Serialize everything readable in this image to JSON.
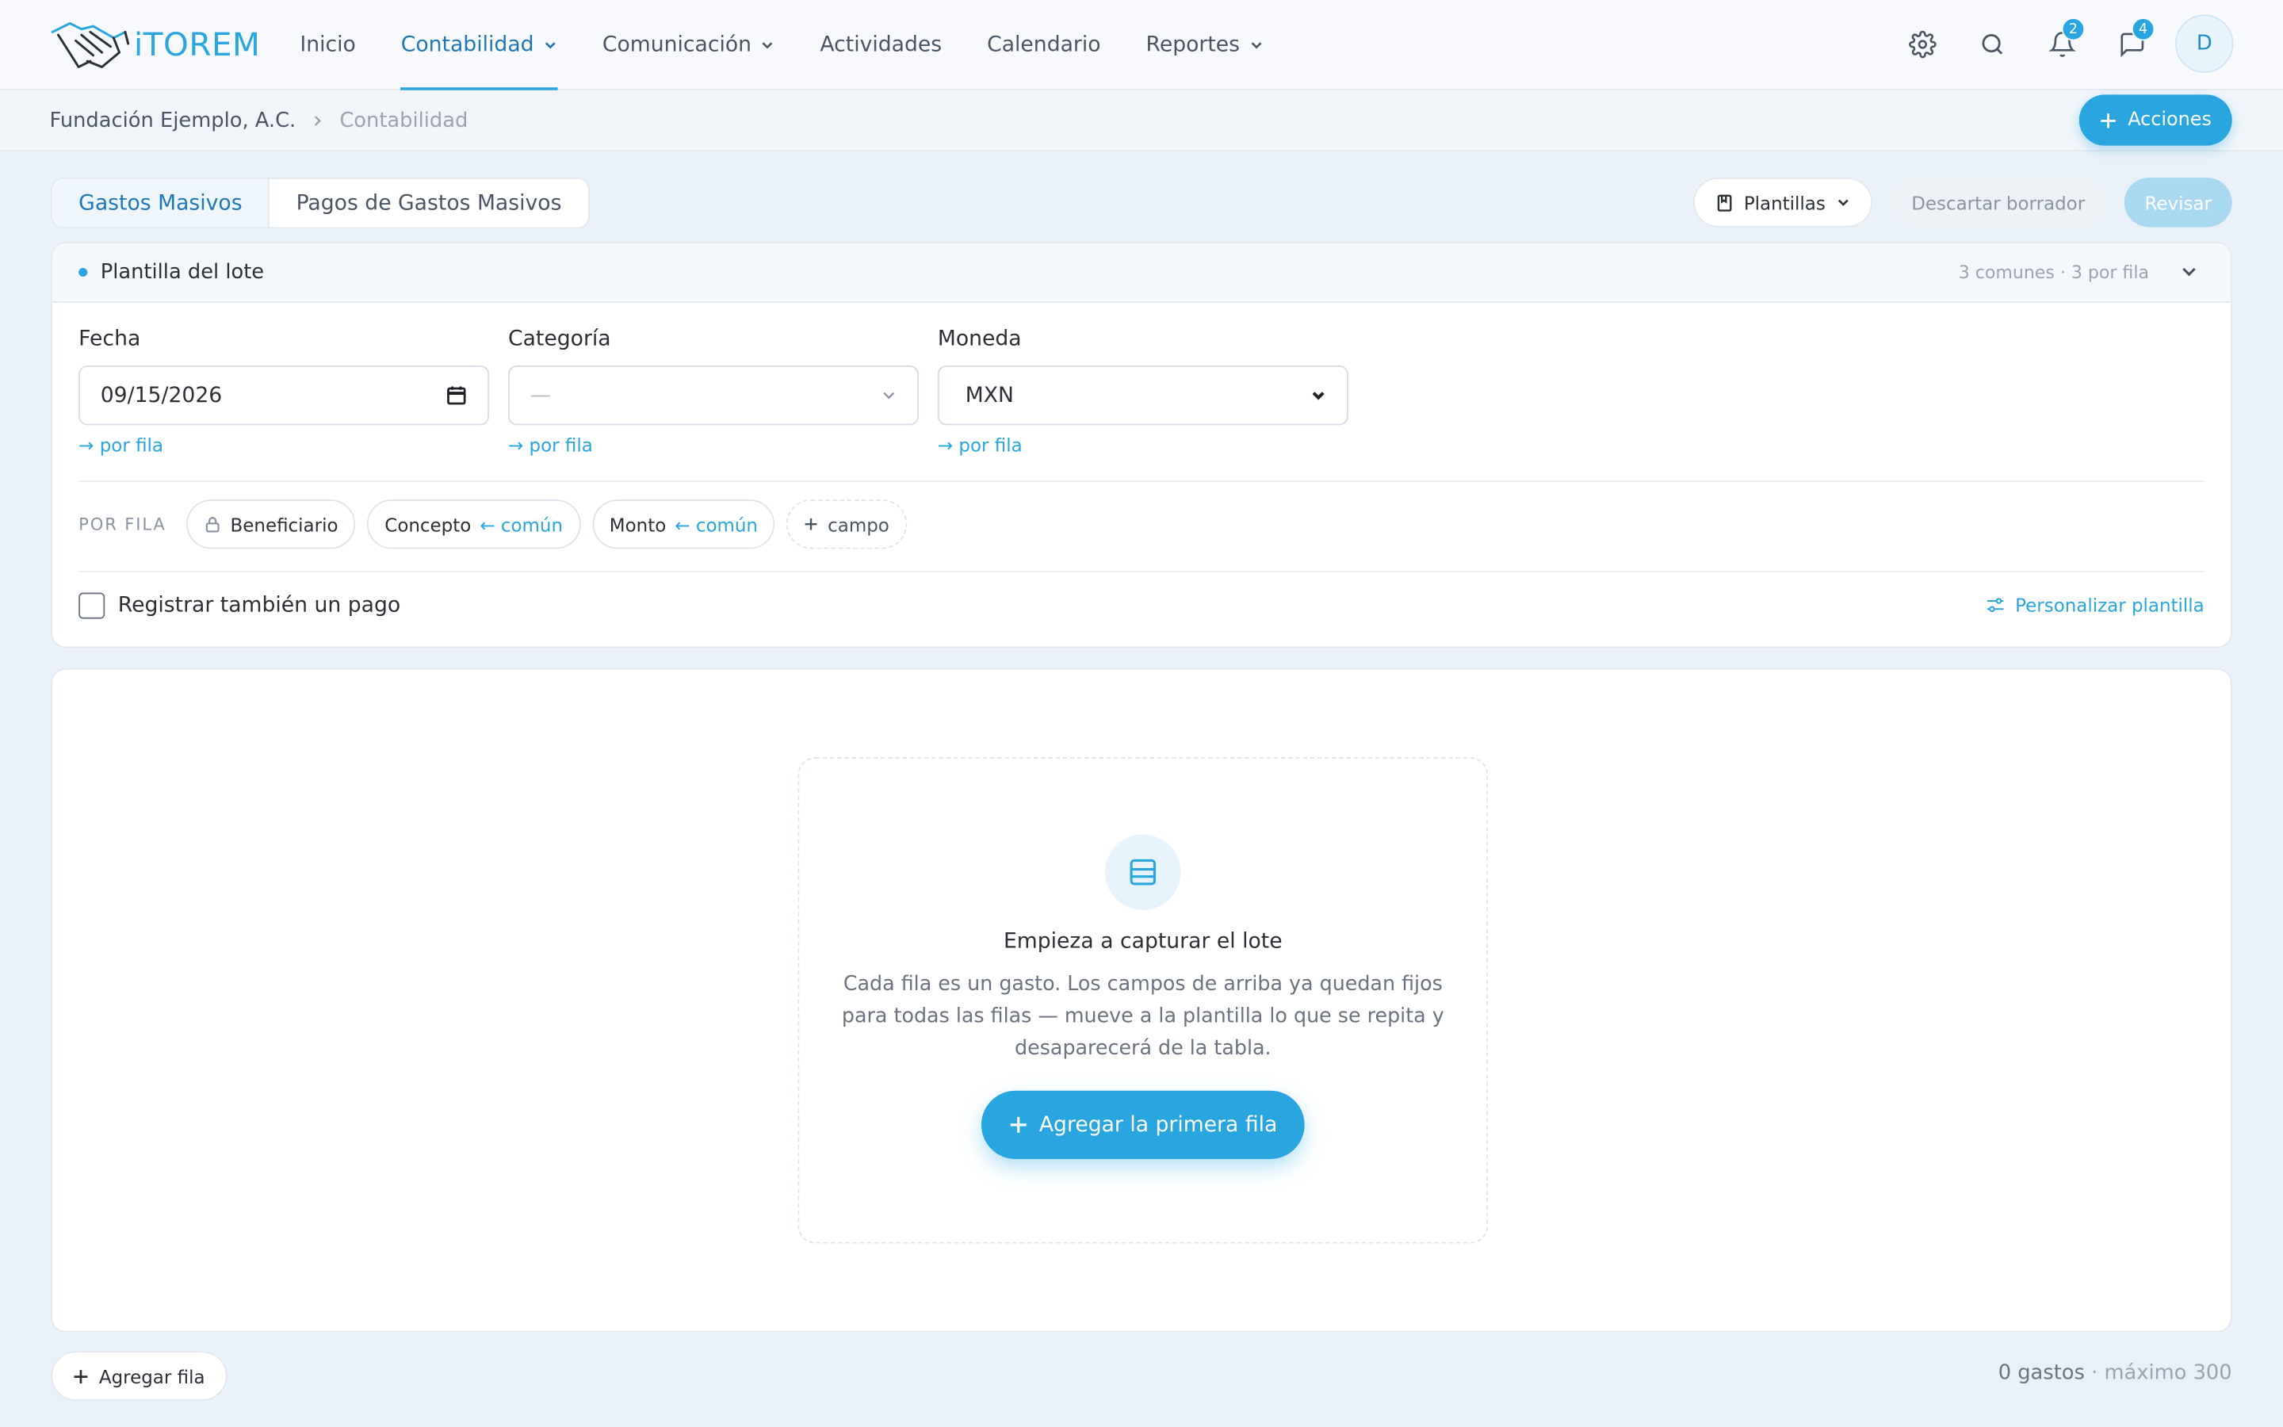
{
  "app": {
    "logo_text": "iTOREM"
  },
  "nav": {
    "items": [
      {
        "label": "Inicio",
        "dropdown": false
      },
      {
        "label": "Contabilidad",
        "dropdown": true,
        "active": true
      },
      {
        "label": "Comunicación",
        "dropdown": true
      },
      {
        "label": "Actividades",
        "dropdown": false
      },
      {
        "label": "Calendario",
        "dropdown": false
      },
      {
        "label": "Reportes",
        "dropdown": true
      }
    ]
  },
  "header": {
    "notifications_count": "2",
    "messages_count": "4",
    "avatar_initial": "D",
    "icons": [
      "gear-icon",
      "search-icon",
      "bell-icon",
      "chat-icon"
    ]
  },
  "breadcrumb": {
    "org": "Fundación Ejemplo, A.C.",
    "section": "Contabilidad"
  },
  "actions_button": "Acciones",
  "tabs": [
    "Gastos Masivos",
    "Pagos de Gastos Masivos"
  ],
  "toolbar": {
    "templates": "Plantillas",
    "discard": "Descartar borrador",
    "review": "Revisar"
  },
  "template": {
    "title": "Plantilla del lote",
    "meta": "3 comunes · 3 por fila",
    "fields": [
      {
        "label": "Fecha",
        "value": "09/15/2026",
        "link": "→ por fila"
      },
      {
        "label": "Categoría",
        "value": "—",
        "link": "→ por fila"
      },
      {
        "label": "Moneda",
        "value": "MXN",
        "link": "→ por fila"
      }
    ],
    "per_row_label": "POR FILA",
    "chips": [
      {
        "label": "Beneficiario",
        "locked": true,
        "common": ""
      },
      {
        "label": "Concepto",
        "locked": false,
        "common": "← común"
      },
      {
        "label": "Monto",
        "locked": false,
        "common": "← común"
      }
    ],
    "add_field": "campo",
    "register_payment": "Registrar también un pago",
    "customize": "Personalizar plantilla"
  },
  "empty_state": {
    "title": "Empieza a capturar el lote",
    "description": "Cada fila es un gasto. Los campos de arriba ya quedan fijos para todas las filas — mueve a la plantilla lo que se repita y desaparecerá de la tabla.",
    "button": "Agregar la primera fila"
  },
  "footer": {
    "add_row": "Agregar fila",
    "count": "0 gastos",
    "max": "· máximo 300"
  },
  "colors": {
    "accent": "#29a6df",
    "accent_dark": "#1f78b4",
    "background": "#eaf0f7"
  }
}
